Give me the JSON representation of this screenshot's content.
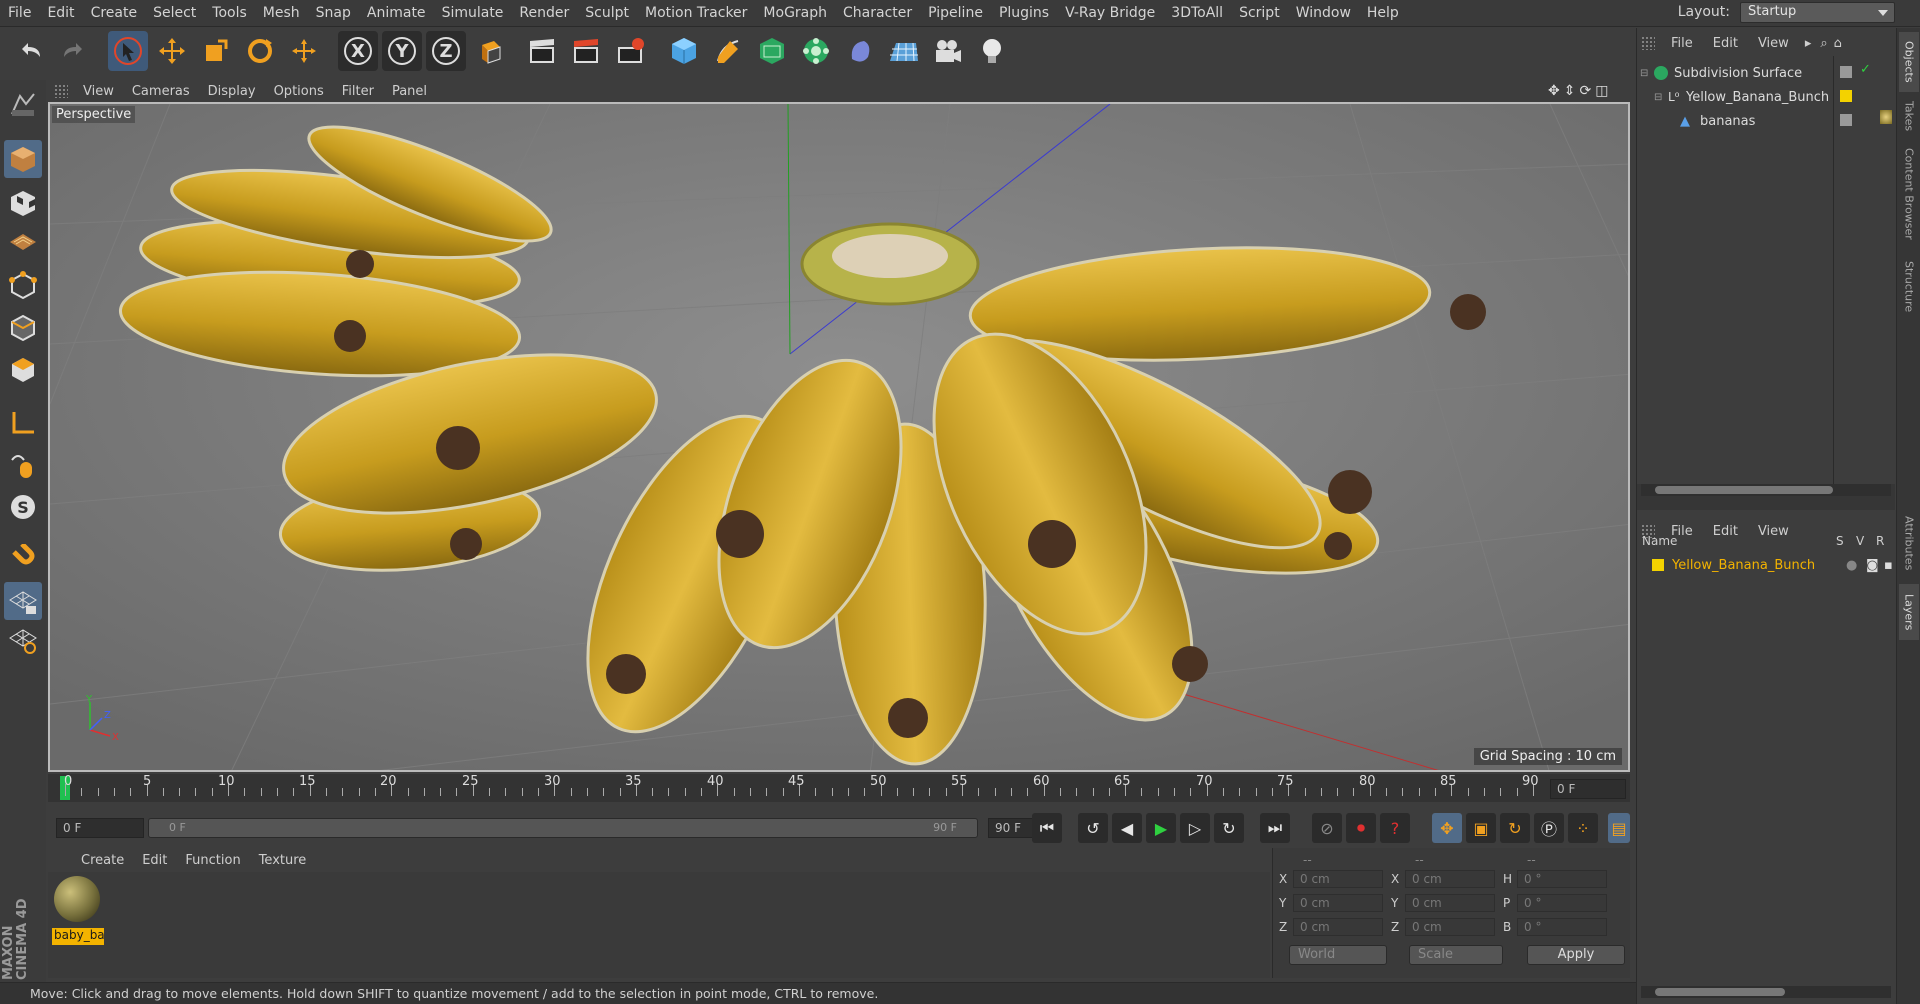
{
  "menubar": {
    "items": [
      "File",
      "Edit",
      "Create",
      "Select",
      "Tools",
      "Mesh",
      "Snap",
      "Animate",
      "Simulate",
      "Render",
      "Sculpt",
      "Motion Tracker",
      "MoGraph",
      "Character",
      "Pipeline",
      "Plugins",
      "V-Ray Bridge",
      "3DToAll",
      "Script",
      "Window",
      "Help"
    ],
    "layout_label": "Layout:",
    "layout_value": "Startup"
  },
  "viewport": {
    "menu": [
      "View",
      "Cameras",
      "Display",
      "Options",
      "Filter",
      "Panel"
    ],
    "label": "Perspective",
    "grid_spacing": "Grid Spacing : 10 cm",
    "axis_labels": {
      "y": "Y",
      "z": "Z",
      "x": "X"
    }
  },
  "timeline": {
    "ticks": [
      "0",
      "5",
      "10",
      "15",
      "20",
      "25",
      "30",
      "35",
      "40",
      "45",
      "50",
      "55",
      "60",
      "65",
      "70",
      "75",
      "80",
      "85",
      "90"
    ],
    "current_frame_field": "0 F"
  },
  "playbar": {
    "start_field": "0 F",
    "range_start": "0 F",
    "range_end": "90 F",
    "end_field": "90 F"
  },
  "materials": {
    "menu": [
      "Create",
      "Edit",
      "Function",
      "Texture"
    ],
    "items": [
      {
        "name": "baby_ba"
      }
    ]
  },
  "coordinates": {
    "header_dashes": [
      "--",
      "--",
      "--"
    ],
    "rows": [
      {
        "l1": "X",
        "v1": "0 cm",
        "l2": "X",
        "v2": "0 cm",
        "l3": "H",
        "v3": "0 °"
      },
      {
        "l1": "Y",
        "v1": "0 cm",
        "l2": "Y",
        "v2": "0 cm",
        "l3": "P",
        "v3": "0 °"
      },
      {
        "l1": "Z",
        "v1": "0 cm",
        "l2": "Z",
        "v2": "0 cm",
        "l3": "B",
        "v3": "0 °"
      }
    ],
    "mode1": "World",
    "mode2": "Scale",
    "apply": "Apply"
  },
  "status": "Move: Click and drag to move elements. Hold down SHIFT to quantize movement / add to the selection in point mode, CTRL to remove.",
  "objects": {
    "menu": [
      "File",
      "Edit",
      "View"
    ],
    "items": [
      {
        "name": "Subdivision Surface",
        "indent": 0
      },
      {
        "name": "Yellow_Banana_Bunch",
        "indent": 1
      },
      {
        "name": "bananas",
        "indent": 2
      }
    ]
  },
  "layers": {
    "menu": [
      "File",
      "Edit",
      "View"
    ],
    "headers": {
      "name": "Name",
      "s": "S",
      "v": "V",
      "r": "R"
    },
    "items": [
      {
        "name": "Yellow_Banana_Bunch",
        "color": "#f3d200"
      }
    ]
  },
  "sidetabs": [
    "Objects",
    "Takes",
    "Content Browser",
    "Structure",
    "Attributes",
    "Layers"
  ],
  "brand": "MAXON CINEMA 4D",
  "colors": {
    "accent": "#516b88",
    "layer_color": "#f3d200",
    "material_tag": "#f3b300"
  }
}
